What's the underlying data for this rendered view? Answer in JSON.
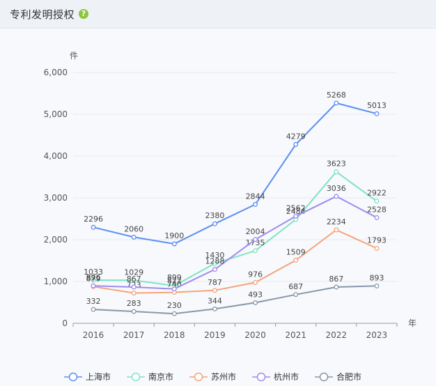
{
  "header": {
    "title": "专利发明授权",
    "help_icon": "question-circle-icon"
  },
  "colors": {
    "上海市": "#5b8ff0",
    "南京市": "#7fe3c4",
    "苏州市": "#f5a37a",
    "杭州市": "#a08af0",
    "合肥市": "#8797aa"
  },
  "chart_data": {
    "type": "line",
    "title": "",
    "ylabel": "件",
    "xlabel": "年",
    "categories": [
      "2016",
      "2017",
      "2018",
      "2019",
      "2020",
      "2021",
      "2022",
      "2023"
    ],
    "ylim": [
      0,
      6000
    ],
    "yticks": [
      "0",
      "1,000",
      "2,000",
      "3,000",
      "4,000",
      "5,000",
      "6,000"
    ],
    "legend_position": "bottom",
    "series": [
      {
        "name": "上海市",
        "values": [
          2296,
          2060,
          1900,
          2380,
          2844,
          4279,
          5268,
          5013
        ]
      },
      {
        "name": "南京市",
        "values": [
          1033,
          1029,
          899,
          1430,
          1735,
          2484,
          3623,
          2922
        ]
      },
      {
        "name": "苏州市",
        "values": [
          879,
          723,
          740,
          787,
          976,
          1509,
          2234,
          1793
        ]
      },
      {
        "name": "杭州市",
        "values": [
          896,
          867,
          822,
          1288,
          2004,
          2562,
          3036,
          2528
        ]
      },
      {
        "name": "合肥市",
        "values": [
          332,
          283,
          230,
          344,
          493,
          687,
          867,
          893
        ]
      }
    ]
  }
}
